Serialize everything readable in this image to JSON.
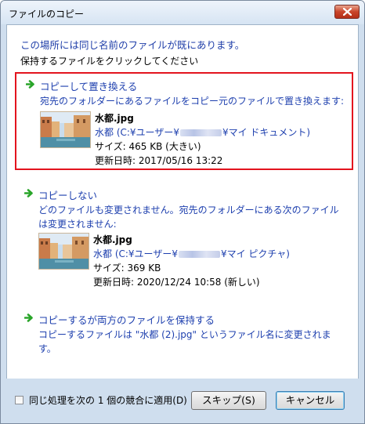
{
  "window": {
    "title": "ファイルのコピー"
  },
  "header": {
    "line1": "この場所には同じ名前のファイルが既にあります。",
    "line2": "保持するファイルをクリックしてください"
  },
  "option_replace": {
    "title": "コピーして置き換える",
    "description": "宛先のフォルダーにあるファイルをコピー元のファイルで置き換えます:",
    "file": {
      "name": "水都.jpg",
      "path_prefix": "水都 (C:¥ユーザー¥",
      "path_suffix": "¥マイ ドキュメント)",
      "size": "サイズ: 465 KB (大きい)",
      "modified": "更新日時: 2017/05/16 13:22"
    }
  },
  "option_skip": {
    "title": "コピーしない",
    "description": "どのファイルも変更されません。宛先のフォルダーにある次のファイルは変更されません:",
    "file": {
      "name": "水都.jpg",
      "path_prefix": "水都 (C:¥ユーザー¥",
      "path_suffix": "¥マイ ピクチャ)",
      "size": "サイズ: 369 KB",
      "modified": "更新日時: 2020/12/24 10:58 (新しい)"
    }
  },
  "option_keep_both": {
    "title": "コピーするが両方のファイルを保持する",
    "description": "コピーするファイルは \"水都 (2).jpg\" というファイル名に変更されます。"
  },
  "footer": {
    "apply_all_label": "同じ処理を次の 1 個の競合に適用(D)",
    "skip_label": "スキップ(S)",
    "cancel_label": "キャンセル"
  },
  "colors": {
    "link_blue": "#1d3fae",
    "selection_red": "#e3141e",
    "arrow_green": "#2aa52a"
  }
}
